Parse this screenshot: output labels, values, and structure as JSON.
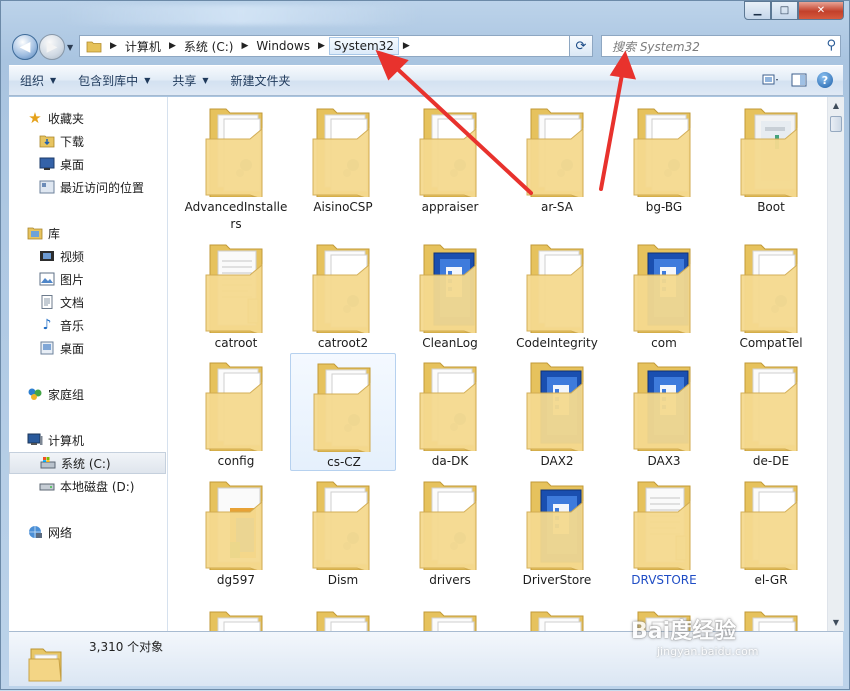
{
  "window": {
    "buttons": {
      "minimize": "▁",
      "maximize": "□",
      "close": "✕"
    }
  },
  "nav_buttons": {
    "back": "◀",
    "forward": "▶",
    "history": "▼"
  },
  "address": {
    "crumbs": [
      "计算机",
      "系统 (C:)",
      "Windows",
      "System32"
    ],
    "refresh": "⟳"
  },
  "search": {
    "placeholder": "搜索 System32"
  },
  "toolbar": {
    "organize": "组织",
    "include_in_library": "包含到库中",
    "share": "共享",
    "new_folder": "新建文件夹",
    "help": "?"
  },
  "sidebar": {
    "favorites": "收藏夹",
    "downloads": "下载",
    "desktop": "桌面",
    "recent": "最近访问的位置",
    "libraries": "库",
    "videos": "视频",
    "pictures": "图片",
    "documents": "文档",
    "music": "音乐",
    "desktop2": "桌面",
    "homegroup": "家庭组",
    "computer": "计算机",
    "drive_c": "系统 (C:)",
    "drive_d": "本地磁盘 (D:)",
    "network": "网络"
  },
  "folders": [
    {
      "name": "AdvancedInstallers",
      "kind": "gear"
    },
    {
      "name": "AisinoCSP",
      "kind": "gear"
    },
    {
      "name": "appraiser",
      "kind": "gear"
    },
    {
      "name": "ar-SA",
      "kind": "gear"
    },
    {
      "name": "bg-BG",
      "kind": "gear"
    },
    {
      "name": "Boot",
      "kind": "doc"
    },
    {
      "name": "catroot",
      "kind": "paper"
    },
    {
      "name": "catroot2",
      "kind": "gear"
    },
    {
      "name": "CleanLog",
      "kind": "blue"
    },
    {
      "name": "CodeIntegrity",
      "kind": "plain"
    },
    {
      "name": "com",
      "kind": "blue"
    },
    {
      "name": "CompatTel",
      "kind": "gear"
    },
    {
      "name": "config",
      "kind": "plain"
    },
    {
      "name": "cs-CZ",
      "kind": "gear"
    },
    {
      "name": "da-DK",
      "kind": "gear"
    },
    {
      "name": "DAX2",
      "kind": "blue"
    },
    {
      "name": "DAX3",
      "kind": "blue"
    },
    {
      "name": "de-DE",
      "kind": "plain"
    },
    {
      "name": "dg597",
      "kind": "color"
    },
    {
      "name": "Dism",
      "kind": "gear"
    },
    {
      "name": "drivers",
      "kind": "gear"
    },
    {
      "name": "DriverStore",
      "kind": "blue"
    },
    {
      "name": "DRVSTORE",
      "kind": "paper"
    },
    {
      "name": "el-GR",
      "kind": "plain"
    }
  ],
  "status": {
    "count": "3,310 个对象"
  },
  "watermark": {
    "brand": "Bai度经验",
    "url": "jingyan.baidu.com"
  },
  "colors": {
    "folder": "#f4d98c",
    "accent": "#1f4dc5",
    "arrow": "#e8322d"
  }
}
